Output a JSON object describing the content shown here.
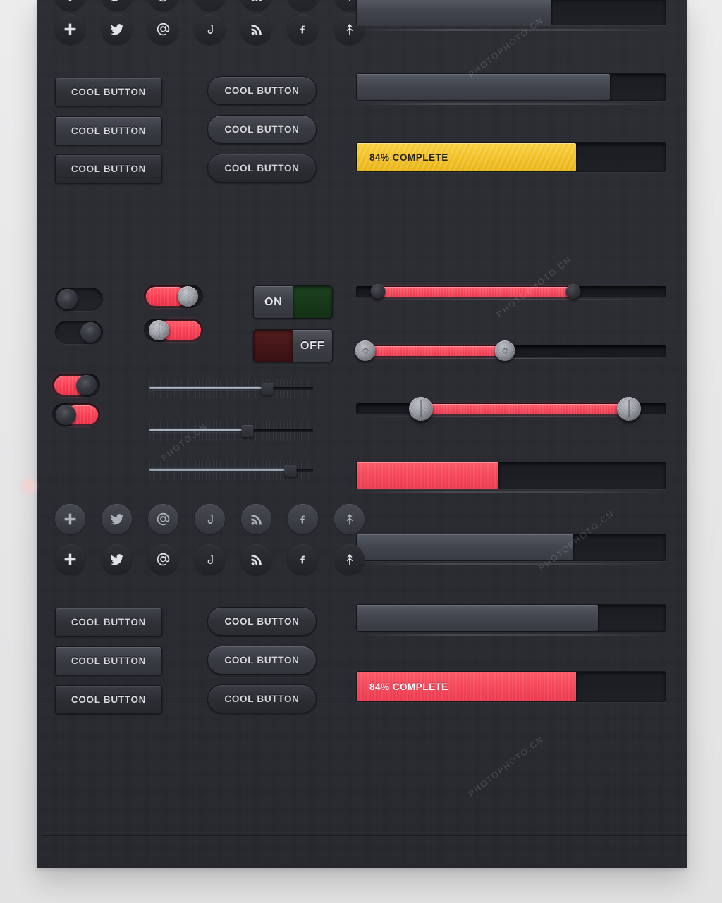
{
  "theme": {
    "panel_bg": "#2a2c32",
    "page_bg": "#e8e8e9",
    "accent_red": "#f4465a",
    "accent_yellow": "#f2c024",
    "accent_green": "#1d4220",
    "text_light": "#d6d9de"
  },
  "labels": {
    "cool_button": "COOL BUTTON",
    "on": "ON",
    "off": "OFF",
    "progress_yellow": "84% COMPLETE",
    "progress_red": "84% COMPLETE"
  },
  "icons": {
    "names": [
      "plus-icon",
      "twitter-icon",
      "at-email-icon",
      "dribbble-icon",
      "rss-icon",
      "facebook-icon",
      "forrst-arrow-icon"
    ]
  },
  "icon_rows": [
    {
      "name": "icon-row-top-cropped",
      "style": "dark",
      "count": 7
    },
    {
      "name": "icon-row-dark-upper",
      "style": "dark",
      "count": 7
    },
    {
      "name": "icon-row-light",
      "style": "light",
      "count": 7
    },
    {
      "name": "icon-row-dark-lower",
      "style": "dark",
      "count": 7
    }
  ],
  "buttons_top": [
    {
      "name": "button-rect-1",
      "label": "COOL BUTTON",
      "shape": "rect",
      "variant": "v1"
    },
    {
      "name": "button-rect-2",
      "label": "COOL BUTTON",
      "shape": "rect",
      "variant": "v2"
    },
    {
      "name": "button-rect-3",
      "label": "COOL BUTTON",
      "shape": "rect",
      "variant": "v3"
    },
    {
      "name": "button-round-1",
      "label": "COOL BUTTON",
      "shape": "round",
      "variant": "v1"
    },
    {
      "name": "button-round-2",
      "label": "COOL BUTTON",
      "shape": "round",
      "variant": "v2"
    },
    {
      "name": "button-round-3",
      "label": "COOL BUTTON",
      "shape": "round",
      "variant": "v3"
    }
  ],
  "buttons_bottom": [
    {
      "name": "button-rect-4",
      "label": "COOL BUTTON",
      "shape": "rect",
      "variant": "v1"
    },
    {
      "name": "button-rect-5",
      "label": "COOL BUTTON",
      "shape": "rect",
      "variant": "v2"
    },
    {
      "name": "button-rect-6",
      "label": "COOL BUTTON",
      "shape": "rect",
      "variant": "v3"
    },
    {
      "name": "button-round-4",
      "label": "COOL BUTTON",
      "shape": "round",
      "variant": "v1"
    },
    {
      "name": "button-round-5",
      "label": "COOL BUTTON",
      "shape": "round",
      "variant": "v2"
    },
    {
      "name": "button-round-6",
      "label": "COOL BUTTON",
      "shape": "round",
      "variant": "v3"
    }
  ],
  "progress_bars": [
    {
      "name": "progress-grey-1",
      "percent": 63,
      "fill": "grey",
      "label": ""
    },
    {
      "name": "progress-grey-2",
      "percent": 82,
      "fill": "grey",
      "label": ""
    },
    {
      "name": "progress-yellow",
      "percent": 71,
      "fill": "yellow",
      "label": "84% COMPLETE"
    },
    {
      "name": "progress-red-partial",
      "percent": 46,
      "fill": "red",
      "label": ""
    },
    {
      "name": "progress-grey-3",
      "percent": 70,
      "fill": "grey",
      "label": ""
    },
    {
      "name": "progress-grey-4",
      "percent": 78,
      "fill": "grey",
      "label": ""
    },
    {
      "name": "progress-red",
      "percent": 71,
      "fill": "red",
      "label": "84% COMPLETE"
    }
  ],
  "toggles": [
    {
      "name": "toggle-dark-off",
      "state": "off",
      "fill": "none",
      "knob": "dark"
    },
    {
      "name": "toggle-dark-on",
      "state": "on",
      "fill": "none",
      "knob": "dark"
    },
    {
      "name": "toggle-red-metal-on",
      "state": "on",
      "fill": "red",
      "knob": "metal"
    },
    {
      "name": "toggle-red-metal-off",
      "state": "off",
      "fill": "red",
      "knob": "metal"
    },
    {
      "name": "toggle-red-dark-on",
      "state": "on",
      "fill": "red",
      "knob": "dark"
    },
    {
      "name": "toggle-red-dark-off",
      "state": "off",
      "fill": "red",
      "knob": "dark"
    }
  ],
  "switches": [
    {
      "name": "switch-on",
      "label": "ON",
      "state": "on",
      "pad": "green"
    },
    {
      "name": "switch-off",
      "label": "OFF",
      "state": "off",
      "pad": "red"
    }
  ],
  "thin_sliders": [
    {
      "name": "thin-slider-1",
      "value": 72
    },
    {
      "name": "thin-slider-2",
      "value": 60
    },
    {
      "name": "thin-slider-3",
      "value": 86
    }
  ],
  "range_sliders": [
    {
      "name": "range-slider-1",
      "low": 7,
      "high": 70,
      "handle": "small"
    },
    {
      "name": "range-slider-2",
      "low": 3,
      "high": 48,
      "handle": "med"
    },
    {
      "name": "range-slider-3",
      "low": 21,
      "high": 88,
      "handle": "big"
    }
  ],
  "watermark": {
    "text_a": "PHOTOPHOTO.CN",
    "text_b": "PHOTOPHOTO.CN",
    "text_c": "PHOTOPHOTO.CN",
    "text_d": "PHOTO.CN",
    "text_e": "PHOTOPHOTO.CN"
  }
}
